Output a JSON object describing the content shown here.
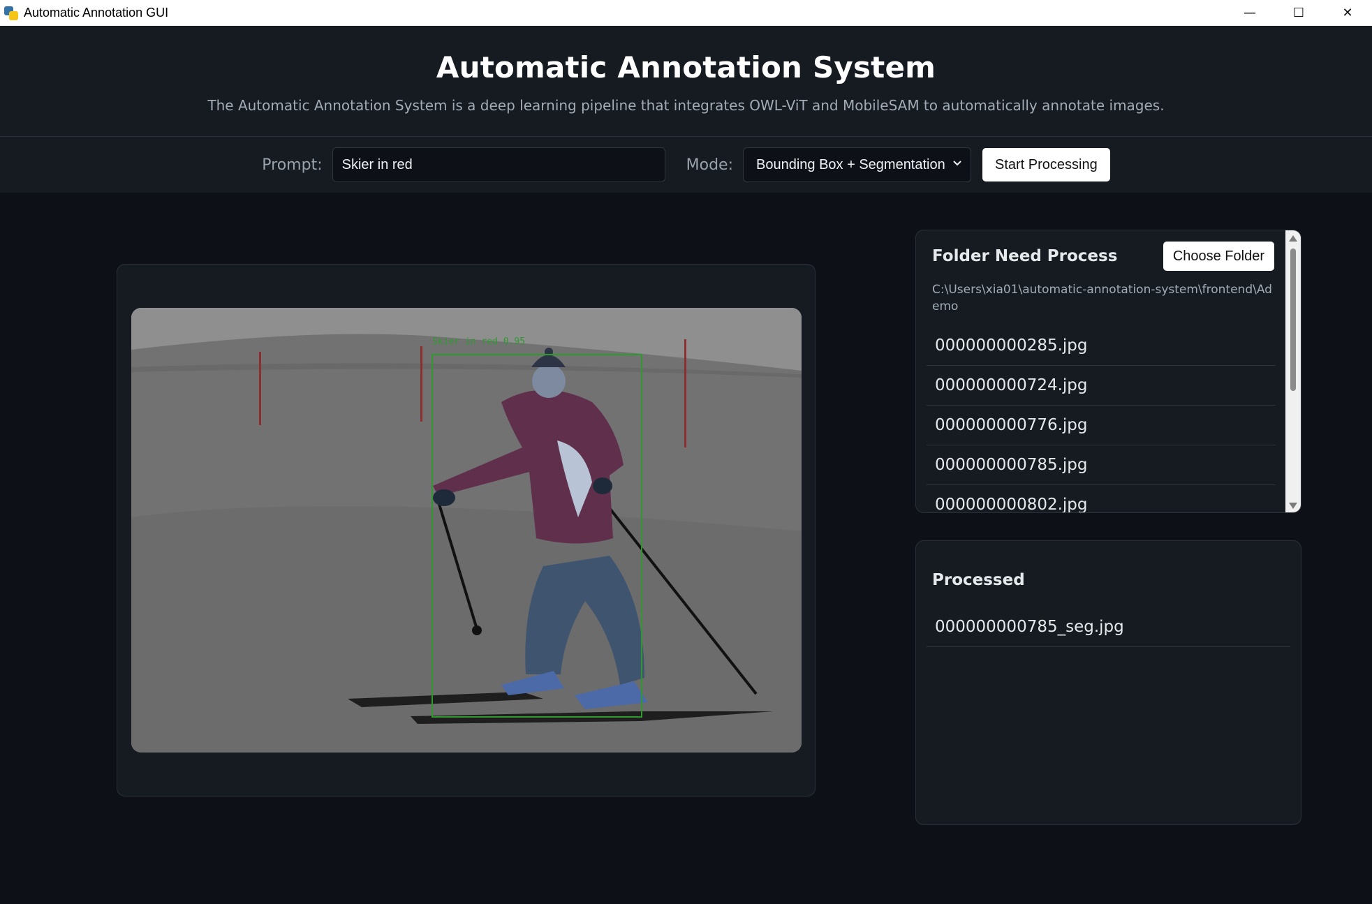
{
  "window": {
    "title": "Automatic Annotation GUI",
    "controls": {
      "minimize": "—",
      "maximize": "☐",
      "close": "✕"
    }
  },
  "header": {
    "title": "Automatic Annotation System",
    "subtitle": "The Automatic Annotation System is a deep learning pipeline that integrates OWL-ViT and MobileSAM to automatically annotate images."
  },
  "toolbar": {
    "prompt_label": "Prompt:",
    "prompt_value": "Skier in red",
    "mode_label": "Mode:",
    "mode_value": "Bounding Box + Segmentation",
    "start_label": "Start Processing"
  },
  "viewer": {
    "detection_label": "Skier in red 0.95",
    "box_color": "#2e9a2e"
  },
  "folder_panel": {
    "title": "Folder Need Process",
    "choose_label": "Choose Folder",
    "path": "C:\\Users\\xia01\\automatic-annotation-system\\frontend\\Ademo",
    "files": [
      "000000000285.jpg",
      "000000000724.jpg",
      "000000000776.jpg",
      "000000000785.jpg",
      "000000000802.jpg"
    ]
  },
  "processed_panel": {
    "title": "Processed",
    "files": [
      "000000000785_seg.jpg"
    ]
  },
  "colors": {
    "background": "#0d1117",
    "panel": "#161b22",
    "border": "#2a3039",
    "text": "#e6e9ec",
    "muted": "#a3acb6"
  }
}
